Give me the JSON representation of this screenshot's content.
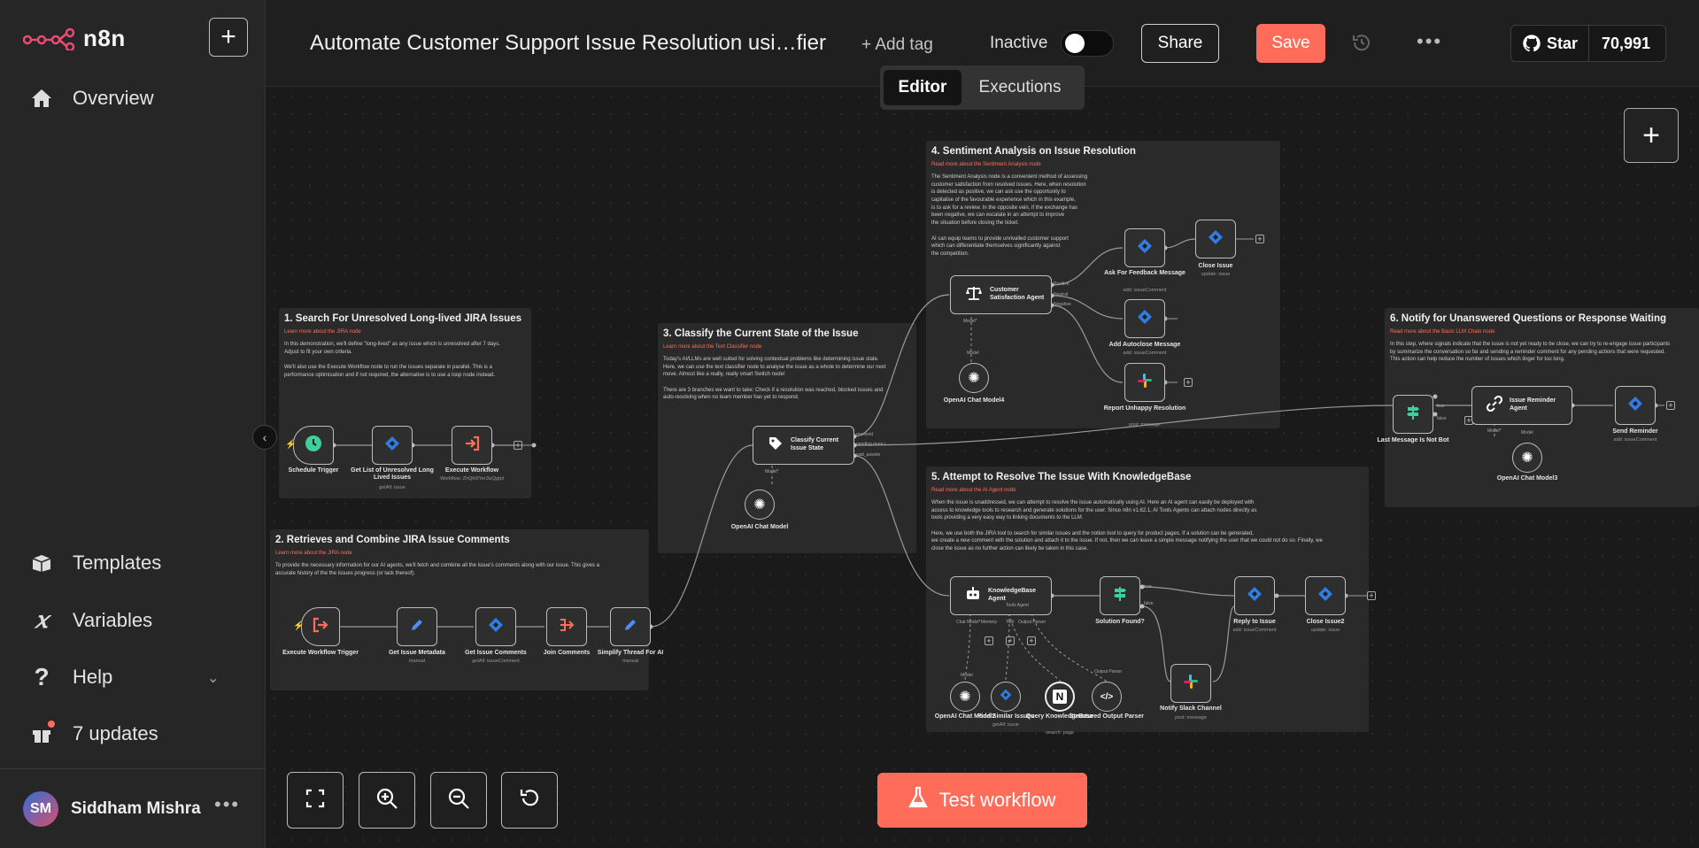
{
  "app": {
    "name": "n8n"
  },
  "sidebar": {
    "items": [
      {
        "label": "Overview",
        "icon": "home-icon"
      },
      {
        "label": "Templates",
        "icon": "box-icon"
      },
      {
        "label": "Variables",
        "icon": "variable-icon"
      },
      {
        "label": "Help",
        "icon": "question-icon"
      },
      {
        "label": "7 updates",
        "icon": "gift-icon"
      }
    ],
    "user": {
      "initials": "SM",
      "name": "Siddham Mishra"
    }
  },
  "header": {
    "title": "Automate Customer Support Issue Resolution usi…fier",
    "add_tag": "+ Add tag",
    "status_label": "Inactive",
    "share": "Share",
    "save": "Save",
    "github_star": "Star",
    "github_count": "70,991",
    "tabs": {
      "editor": "Editor",
      "executions": "Executions"
    }
  },
  "notes": {
    "n1": {
      "title": "1. Search For Unresolved Long-lived JIRA Issues",
      "link": "Learn more about the JIRA node",
      "body": "In this demonstration, we'll define \"long-lived\" as any issue which is unresolved after 7 days.\nAdjust to fit your own criteria.\n\nWe'll also use the Execute Workflow node to run the issues separate in parallel. This is a\nperformance optimisation and if not required, the alternative is to use a loop node instead."
    },
    "n2": {
      "title": "2. Retrieves and Combine JIRA Issue Comments",
      "link": "Learn more about the JIRA node",
      "body": "To provide the necessary information for our AI agents, we'll fetch and combine all the issue's comments along with our issue. This gives a\naccurate history of the the issues progress (or lack thereof)."
    },
    "n3": {
      "title": "3. Classify the Current State of the Issue",
      "link": "Learn more about the Text Classifier node",
      "body": "Today's AI/LLMs are well suited for solving contextual problems like determining issue state.\nHere, we can use the text classifier node to analyse the issue as a whole to determine our next\nmove. Almost like a really, really smart Switch node!\n\nThere are 3 branches we want to take: Check if a resolution was reached, blocked issues and\nauto-resolving when no team member has yet to respond."
    },
    "n4": {
      "title": "4. Sentiment Analysis on Issue Resolution",
      "link": "Read more about the Sentiment Analysis node",
      "body": "The Sentiment Analysis node is a convenient method of assessing\ncustomer satisfaction from resolved issues. Here, when resolution\nis detected as positive, we can ask use the opportunity to\ncapitalise of the favourable experience which in this example,\nis to ask for a review. In the opposite vein, if the exchange has\nbeen negative, we can escalate in an attempt to improve\nthe situation before closing the ticket.\n\nAI can equip teams to provide unrivalled customer support\nwhich can differentiate themselves significantly against\nthe competition."
    },
    "n5": {
      "title": "5. Attempt to Resolve The Issue With KnowledgeBase",
      "link": "Read more about the AI Agent node",
      "body": "When the issue is unaddressed, we can attempt to resolve the issue automatically using AI. Here an AI agent can easily be deployed with\naccess to knowledge tools to research and generate solutions for the user. Since n8n v1.62.1, AI Tools Agents can attach nodes directly as\ntools providing a very easy way to linking documents to the LLM.\n\nHere, we use both the JIRA tool to search for similar issues and the notion tool to query for product pages. If a solution can be generated,\nwe create a new comment with the solution and attach it to the issue. If not, then we can leave a simple message notifying the user that we could not do so. Finally, we\nclose the issue as no further action can likely be taken in this case."
    },
    "n6": {
      "title": "6. Notify for Unanswered Questions or Response Waiting",
      "link": "Read more about the Basic LLM Chain node",
      "body": "In this step, where signals indicate that the issue is not yet ready to be close, we can try to re-engage issue participants\nby summarize the conversation so far and sending a reminder comment for any pending actions that were requested.\nThis action can help reduce the number of issues which linger for too long."
    }
  },
  "nodes": {
    "schedule": {
      "label": "Schedule Trigger",
      "sub": ""
    },
    "get_issues": {
      "label": "Get List of Unresolved Long Lived Issues",
      "sub": "getAll: issue"
    },
    "exec_wf": {
      "label": "Execute Workflow",
      "sub": "Workflow: ZhQk0IYer3lzQgtpl"
    },
    "exec_trigger": {
      "label": "Execute Workflow Trigger",
      "sub": ""
    },
    "get_meta": {
      "label": "Get Issue Metadata",
      "sub": "manual"
    },
    "get_comments": {
      "label": "Get Issue Comments",
      "sub": "getAll: issueComment"
    },
    "join_comments": {
      "label": "Join Comments",
      "sub": ""
    },
    "simplify": {
      "label": "Simplify Thread For AI",
      "sub": "manual"
    },
    "classify": {
      "label": "Classify Current Issue State",
      "sub": "",
      "model_label": "Model*",
      "outputs": [
        "resolved",
        "pending more i...",
        "wait_assiste"
      ]
    },
    "openai_1": {
      "label": "OpenAI Chat Model",
      "sub": ""
    },
    "csat": {
      "label": "Customer Satisfaction Agent",
      "sub": "",
      "model_label": "Model*",
      "outputs": [
        "Positive",
        "Neutral",
        "Negative"
      ]
    },
    "openai_4": {
      "label": "OpenAI Chat Model4",
      "sub": "",
      "model_label": "Model"
    },
    "ask_feedback": {
      "label": "Ask For Feedback Message",
      "sub": "add: issueComment"
    },
    "close_issue": {
      "label": "Close Issue",
      "sub": "update: issue"
    },
    "autoclose": {
      "label": "Add Autoclose Message",
      "sub": "add: issueComment"
    },
    "report_unhappy": {
      "label": "Report Unhappy Resolution",
      "sub": "post: message"
    },
    "kb_agent": {
      "label": "KnowledgeBase Agent",
      "sub": "Tools Agent",
      "ports": [
        "Chat Model*",
        "Memory",
        "Tool",
        "Output Parser"
      ]
    },
    "solution_found": {
      "label": "Solution Found?",
      "sub": "",
      "outputs": [
        "true",
        "false"
      ]
    },
    "reply_issue": {
      "label": "Reply to Issue",
      "sub": "add: issueComment"
    },
    "close_issue2": {
      "label": "Close Issue2",
      "sub": "update: issue"
    },
    "notify_slack": {
      "label": "Notify Slack Channel",
      "sub": "post: message"
    },
    "openai_2": {
      "label": "OpenAI Chat Model2",
      "sub": "",
      "port": "Model"
    },
    "find_similar": {
      "label": "Find Similar Issues",
      "sub": "getAll: issue"
    },
    "query_kb": {
      "label": "Query KnowledgeBase",
      "sub": "search: page"
    },
    "struct_parser": {
      "label": "Structured Output Parser",
      "sub": "",
      "port": "Output Parser"
    },
    "last_msg": {
      "label": "Last Message Is Not Bot",
      "sub": "",
      "outputs": [
        "true",
        "false"
      ]
    },
    "issue_reminder": {
      "label": "Issue Reminder Agent",
      "sub": "",
      "model_label": "Model*"
    },
    "send_reminder": {
      "label": "Send Reminder",
      "sub": "add: issueComment"
    },
    "openai_3": {
      "label": "OpenAI Chat Model3",
      "sub": "",
      "model_label": "Model"
    }
  },
  "controls": {
    "test_workflow": "Test workflow"
  },
  "colors": {
    "accent": "#ff6d5a",
    "jira_blue": "#2f7de1",
    "schedule_green": "#3ecf9b"
  }
}
